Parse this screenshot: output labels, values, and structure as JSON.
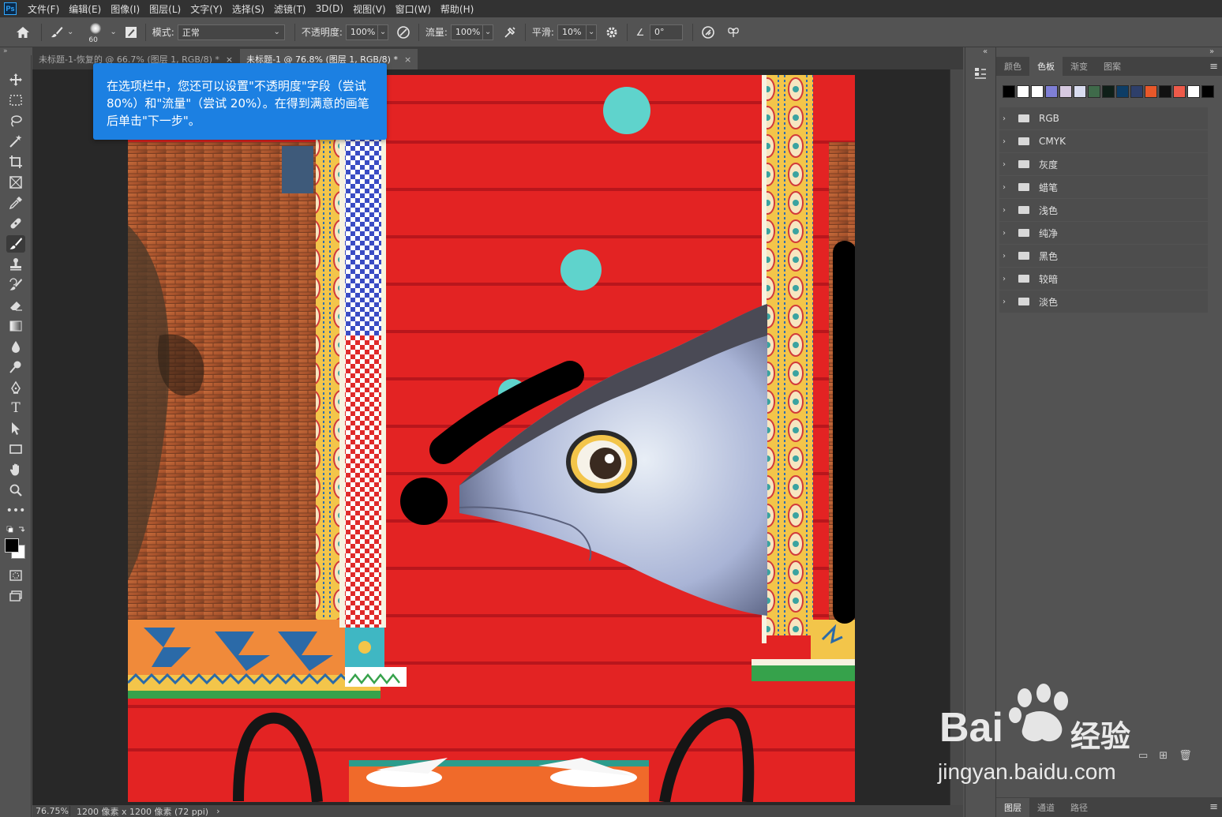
{
  "app": {
    "logo": "Ps"
  },
  "menu": [
    "文件(F)",
    "编辑(E)",
    "图像(I)",
    "图层(L)",
    "文字(Y)",
    "选择(S)",
    "滤镜(T)",
    "3D(D)",
    "视图(V)",
    "窗口(W)",
    "帮助(H)"
  ],
  "options": {
    "brush_size": "60",
    "mode_label": "模式:",
    "mode_value": "正常",
    "opacity_label": "不透明度:",
    "opacity_value": "100%",
    "flow_label": "流量:",
    "flow_value": "100%",
    "smoothing_label": "平滑:",
    "smoothing_value": "10%",
    "angle_value": "0°"
  },
  "tabs": [
    {
      "label": "未标题-1-恢复的 @ 66.7% (图层 1, RGB/8) *",
      "close": "×"
    },
    {
      "label": "未标题-1 @ 76.8% (图层 1, RGB/8) *",
      "close": "×"
    }
  ],
  "callout": {
    "text": "在选项栏中，您还可以设置\"不透明度\"字段（尝试 80%）和\"流量\"（尝试 20%）。在得到满意的画笔后单击\"下一步\"。"
  },
  "status": {
    "zoom": "76.75%",
    "info": "1200 像素 x 1200 像素 (72 ppi)"
  },
  "panel": {
    "tabs": [
      "颜色",
      "色板",
      "渐变",
      "图案"
    ],
    "active_tab": "色板",
    "swatch_colors": [
      "#000000",
      "#ffffff",
      "#ffffff",
      "#7f7fd6",
      "#d6c9e0",
      "#d9dcf0",
      "#3f6a4a",
      "#0f1f18",
      "#0d3d66",
      "#2e3f6a",
      "#e8582a",
      "#111111",
      "#ee5a4a",
      "#ffffff",
      "#000000"
    ],
    "groups": [
      "RGB",
      "CMYK",
      "灰度",
      "蜡笔",
      "浅色",
      "纯净",
      "黑色",
      "较暗",
      "淡色"
    ],
    "bottom_tabs": [
      "图层",
      "通道",
      "路径"
    ]
  },
  "watermark": {
    "brand": "Bai",
    "brand2": "经验",
    "url": "jingyan.baidu.com"
  },
  "colors": {
    "accent": "#1c80e2",
    "canvas_red": "#e32323",
    "ui_dark": "#323232",
    "ui_mid": "#535353"
  }
}
